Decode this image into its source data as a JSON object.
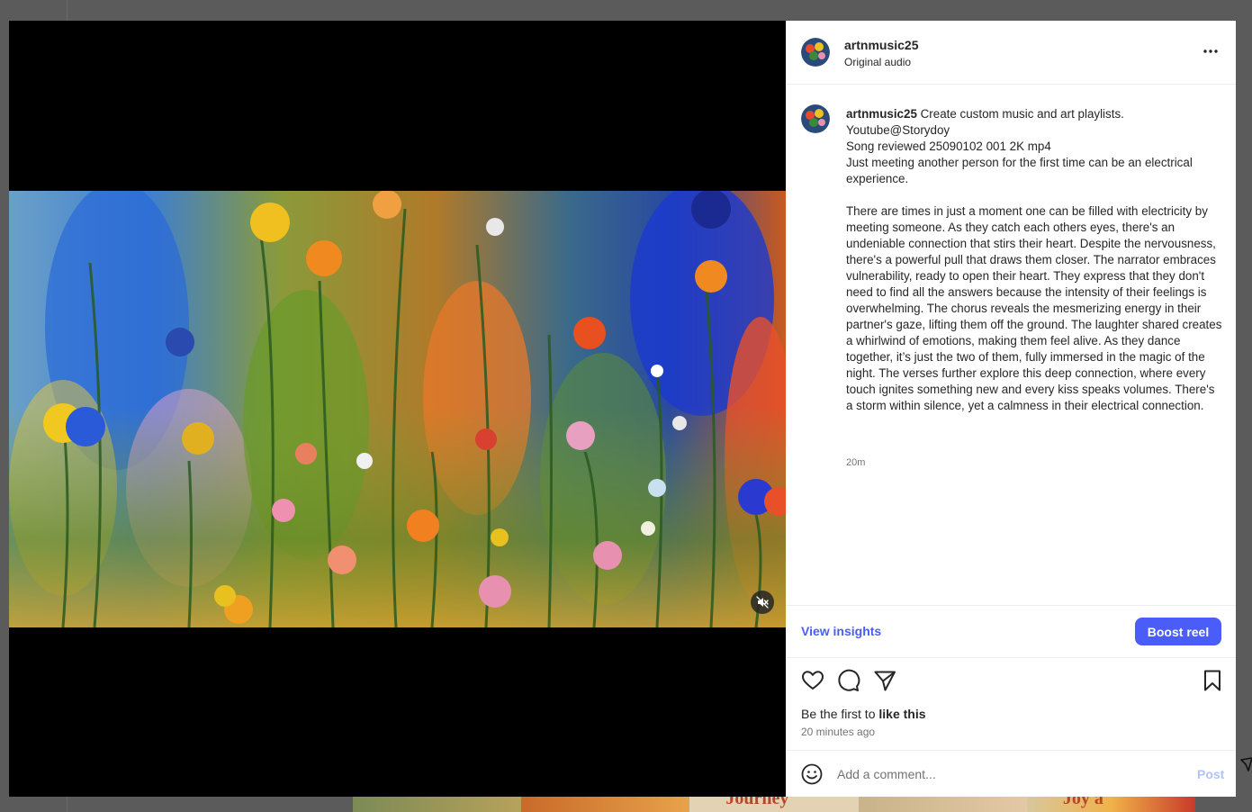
{
  "post": {
    "username": "artnmusic25",
    "audio": "Original audio",
    "caption": {
      "username": "artnmusic25",
      "text": " Create custom music and art playlists.\nYoutube@Storydoy\nSong reviewed 25090102 001 2K mp4\nJust meeting another person for the first time can be an electrical experience.\n\nThere are times in just a moment one can be filled with electricity by meeting someone. As they catch each others eyes, there's an undeniable connection that stirs their heart. Despite the nervousness, there's a powerful pull that draws them closer. The narrator embraces vulnerability, ready to open their heart. They express that they don't need to find all the answers because the intensity of their feelings is overwhelming. The chorus reveals the mesmerizing energy in their partner's gaze, lifting them off the ground. The laughter shared creates a whirlwind of emotions, making them feel alive. As they dance together, it’s just the two of them, fully immersed in the magic of the night. The verses further explore this deep connection, where every touch ignites something new and every kiss speaks volumes. There's a storm within silence, yet a calmness in their electrical connection.",
      "time": "20m"
    },
    "insights_label": "View insights",
    "boost_label": "Boost reel",
    "likes_prefix": "Be the first to ",
    "likes_link": "like this",
    "posted_ago": "20 minutes ago",
    "comment_placeholder": "Add a comment...",
    "post_label": "Post"
  },
  "background": {
    "tile_words": [
      "",
      "",
      "Journey",
      "",
      "Joy a"
    ]
  },
  "colors": {
    "accent": "#4a5df9",
    "post_disabled": "#b2c2fb"
  },
  "icons": [
    "more-options-icon",
    "mute-icon",
    "heart-icon",
    "comment-icon",
    "share-icon",
    "bookmark-icon",
    "emoji-icon"
  ]
}
